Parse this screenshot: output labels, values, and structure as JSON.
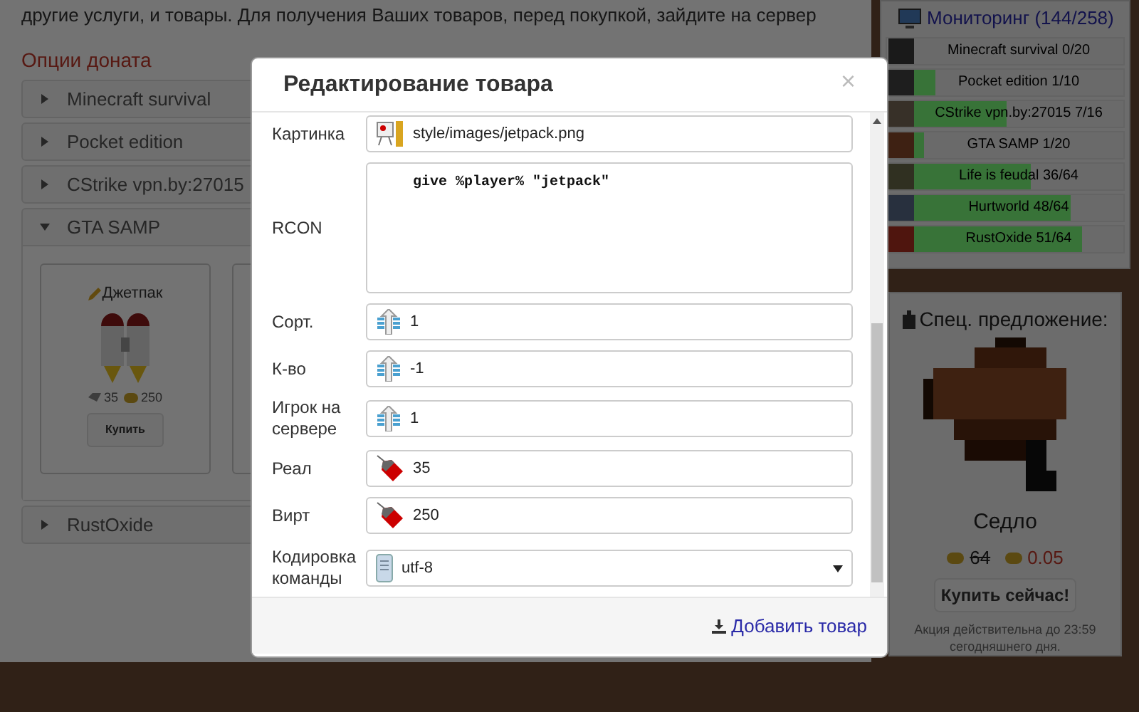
{
  "page": {
    "intro": "другие услуги, и товары. Для получения Ваших товаров, перед покупкой, зайдите на сервер",
    "options_title": "Опции доната",
    "servers": [
      {
        "name": "Minecraft survival",
        "expanded": false
      },
      {
        "name": "Pocket edition",
        "expanded": false
      },
      {
        "name": "CStrike vpn.by:27015",
        "expanded": false
      },
      {
        "name": "GTA SAMP",
        "expanded": true,
        "products": [
          {
            "name": "Джетпак",
            "real": "35",
            "virt": "250",
            "button": "Купить"
          }
        ]
      },
      {
        "name": "RustOxide",
        "expanded": false
      }
    ]
  },
  "monitoring": {
    "title": "Мониторинг (144/258)",
    "servers": [
      {
        "label": "Minecraft survival 0/20",
        "level": 0
      },
      {
        "label": "Pocket edition 1/10",
        "level": 0.1
      },
      {
        "label": "CStrike vpn.by:27015 7/16",
        "level": 0.44
      },
      {
        "label": "GTA SAMP 1/20",
        "level": 0.05
      },
      {
        "label": "Life is feudal 36/64",
        "level": 0.56
      },
      {
        "label": "Hurtworld 48/64",
        "level": 0.75
      },
      {
        "label": "RustOxide 51/64",
        "level": 0.8
      }
    ]
  },
  "offer": {
    "title": "Спец. предложение:",
    "name": "Седло",
    "old_price": "64",
    "new_price": "0.05",
    "button": "Купить сейчас!",
    "note": "Акция действительна до 23:59 сегодняшнего дня."
  },
  "modal": {
    "title": "Редактирование товара",
    "close": "×",
    "fields": [
      {
        "label": "Картинка",
        "kind": "image",
        "value": "style/images/jetpack.png"
      },
      {
        "label": "RCON",
        "kind": "textarea",
        "value": "    give %player% \"jetpack\""
      },
      {
        "label": "Сорт.",
        "kind": "number",
        "value": "1"
      },
      {
        "label": "К-во",
        "kind": "number",
        "value": "-1"
      },
      {
        "label": "Игрок на сервере",
        "kind": "number",
        "value": "1"
      },
      {
        "label": "Реал",
        "kind": "price",
        "value": "35"
      },
      {
        "label": "Вирт",
        "kind": "price",
        "value": "250"
      },
      {
        "label": "Кодировка команды",
        "kind": "select",
        "value": "utf-8"
      }
    ],
    "submit": "Добавить товар"
  }
}
